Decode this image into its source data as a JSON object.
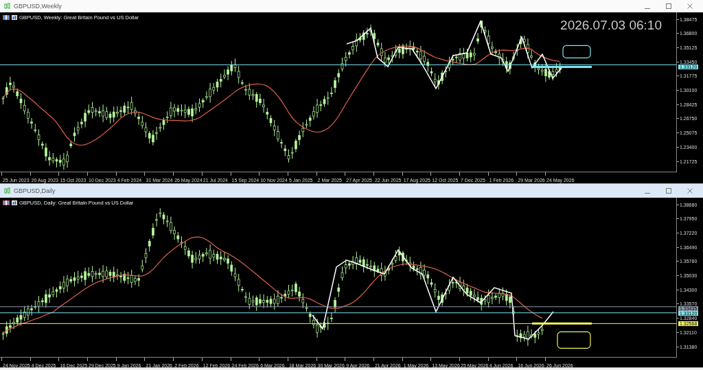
{
  "windows": [
    {
      "title": "GBPUSD,Weekly",
      "active": false,
      "header": "GBPUSD, Weekly:  Great Britain Pound vs US Dollar",
      "timestamp": "2026.07.03 06:10",
      "price_ticks": [
        "1.38475",
        "1.36800",
        "1.35125",
        "1.33450",
        "1.31775",
        "1.30100",
        "1.28425",
        "1.26750",
        "1.25075",
        "1.23400",
        "1.21725"
      ],
      "price_tags": [
        {
          "text": "1.33120",
          "color": "#7fe7f2"
        }
      ],
      "dates": [
        "25 Jun 2023",
        "20 Aug 2023",
        "15 Oct 2023",
        "10 Dec 2023",
        "4 Feb 2024",
        "31 Mar 2024",
        "26 May 2024",
        "21 Jul 2024",
        "15 Sep 2024",
        "10 Nov 2024",
        "5 Jan 2025",
        "2 Mar 2025",
        "27 Apr 2025",
        "22 Jun 2025",
        "17 Aug 2025",
        "12 Oct 2025",
        "7 Dec 2025",
        "1 Feb 2026",
        "29 Mar 2026",
        "24 May 2026"
      ]
    },
    {
      "title": "GBPUSD,Daily",
      "active": true,
      "header": "GBPUSD, Daily:  Great Britain Pound vs US Dollar",
      "price_ticks": [
        "1.38680",
        "1.37950",
        "1.37220",
        "1.36490",
        "1.35760",
        "1.35030",
        "1.34300",
        "1.33570",
        "1.32840",
        "1.32110",
        "1.31380"
      ],
      "price_tags": [
        {
          "text": "1.33435",
          "color": "#8a9aa8"
        },
        {
          "text": "1.33120",
          "color": "#7fe7f2"
        },
        {
          "text": "1.32568",
          "color": "#f2f25a"
        }
      ],
      "dates": [
        "24 Nov 2025",
        "4 Dec 2025",
        "16 Dec 2025",
        "29 Dec 2025",
        "9 Jan 2026",
        "21 Jan 2026",
        "2 Feb 2026",
        "12 Feb 2026",
        "24 Feb 2026",
        "6 Mar 2026",
        "18 Mar 2026",
        "30 Mar 2026",
        "9 Apr 2026",
        "21 Apr 2026",
        "1 May 2026",
        "13 May 2026",
        "25 May 2026",
        "4 Jun 2026",
        "16 Jun 2026",
        "26 Jun 2026"
      ]
    }
  ]
}
